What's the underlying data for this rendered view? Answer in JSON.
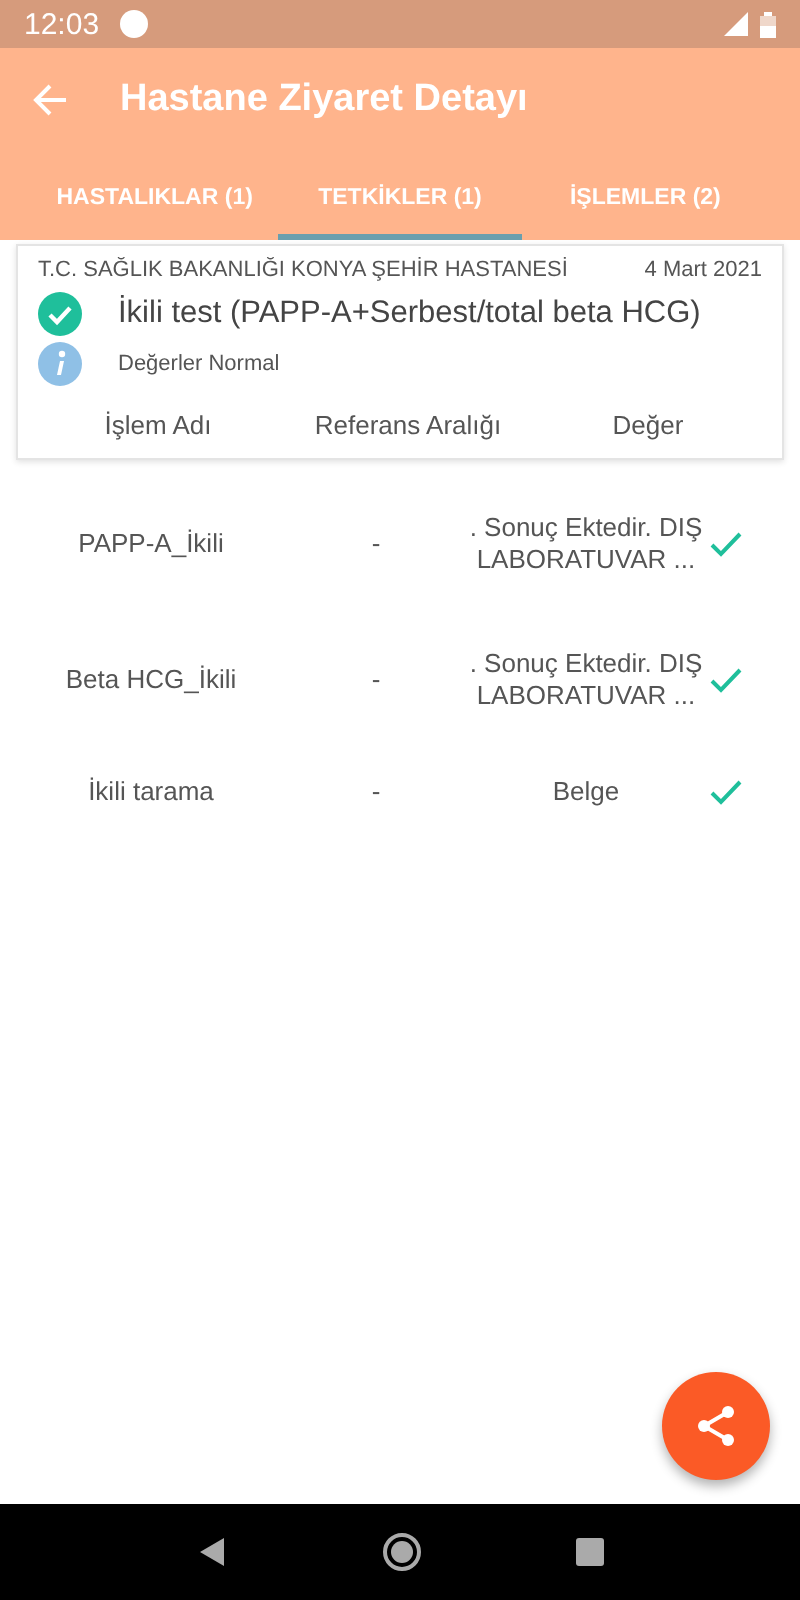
{
  "status_bar": {
    "time": "12:03"
  },
  "app_bar": {
    "title": "Hastane Ziyaret Detayı"
  },
  "tabs": [
    {
      "label": "HASTALIKLAR (1)",
      "selected": false
    },
    {
      "label": "TETKİKLER (1)",
      "selected": true
    },
    {
      "label": "İŞLEMLER (2)",
      "selected": false
    }
  ],
  "card": {
    "hospital": "T.C. SAĞLIK BAKANLIĞI KONYA ŞEHİR HASTANESİ",
    "date": "4 Mart 2021",
    "test_name": "İkili test (PAPP-A+Serbest/total beta HCG)",
    "completed": true,
    "note": "Değerler Normal",
    "columns": [
      "İşlem Adı",
      "Referans Aralığı",
      "Değer"
    ]
  },
  "rows": [
    {
      "name": "PAPP-A_İkili",
      "reference": "-",
      "value": ". Sonuç Ektedir. DIŞ LABORATUVAR ...",
      "checked": true
    },
    {
      "name": "Beta HCG_İkili",
      "reference": "-",
      "value": ". Sonuç Ektedir. DIŞ LABORATUVAR ...",
      "checked": true
    },
    {
      "name": "İkili tarama",
      "reference": "-",
      "value": "Belge",
      "checked": true
    }
  ]
}
